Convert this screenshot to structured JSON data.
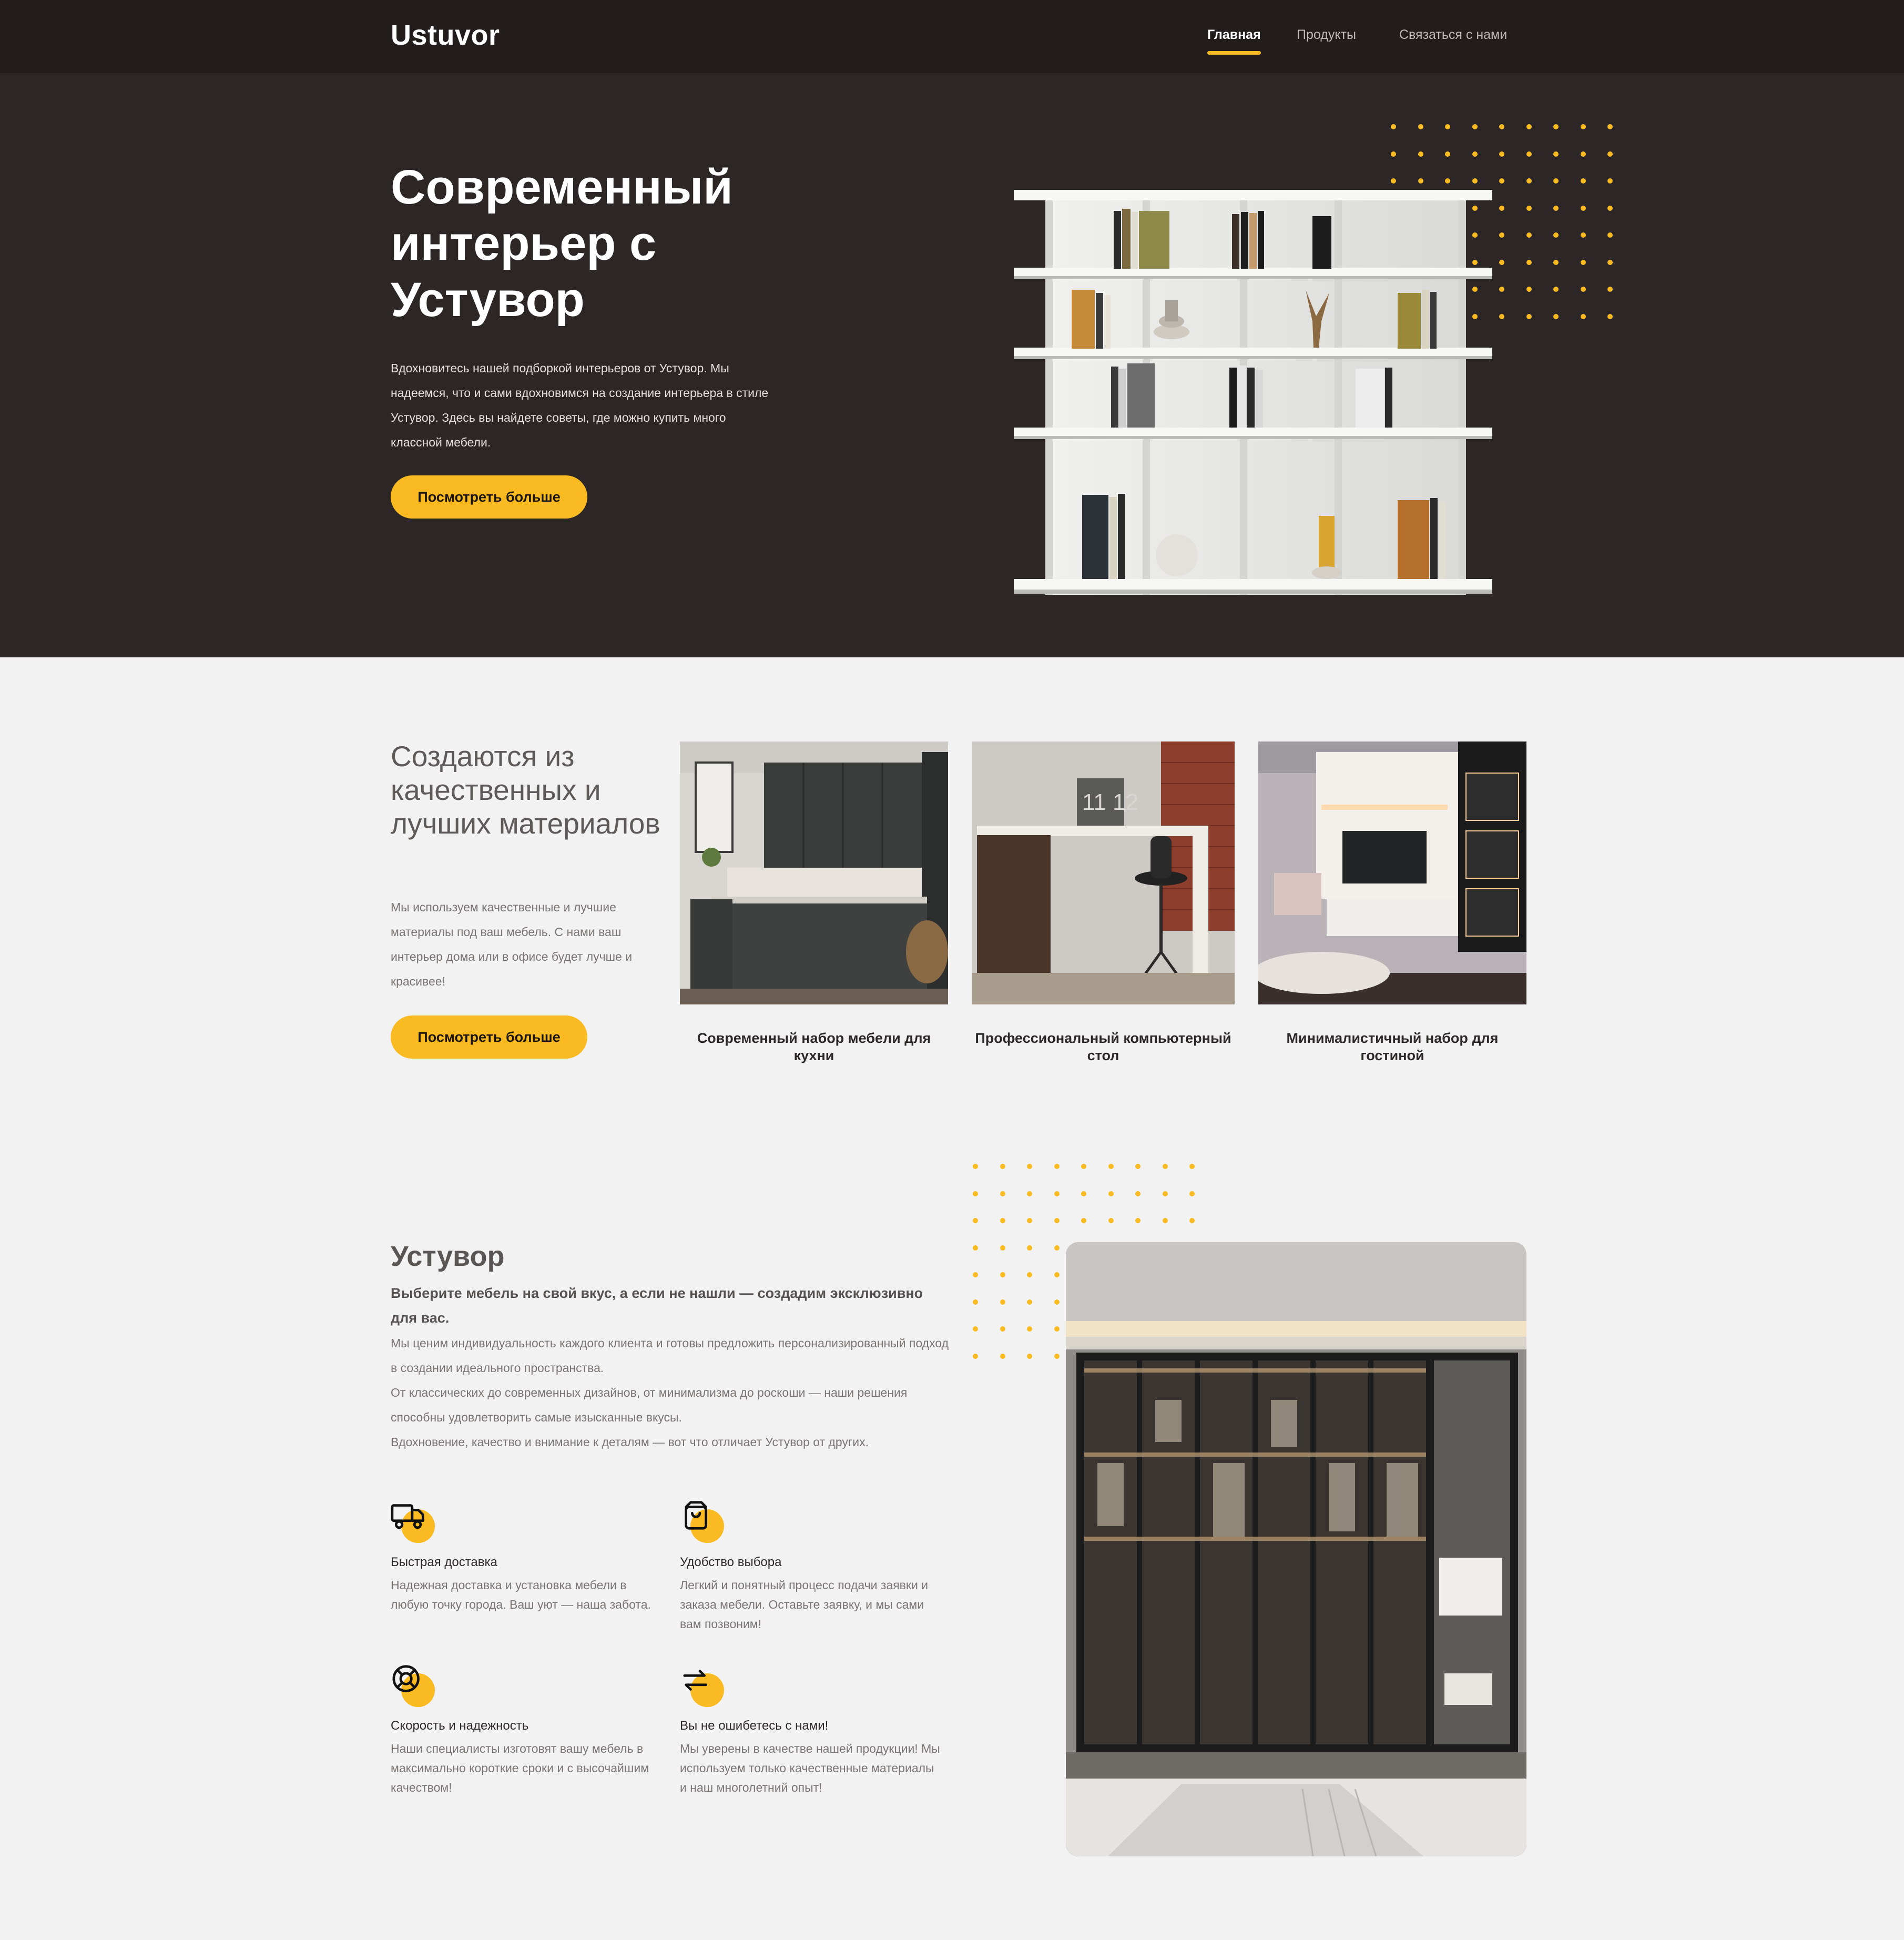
{
  "header": {
    "logo": "Ustuvor",
    "nav": [
      {
        "label": "Главная",
        "active": true
      },
      {
        "label": "Продукты",
        "active": false
      },
      {
        "label": "Связаться с нами",
        "active": false
      }
    ]
  },
  "hero": {
    "title": "Современный интерьер с Устувор",
    "text": "Вдохновитесь нашей подборкой интерьеров от Устувор. Мы надеемся, что и сами вдохновимся на создание интерьера в стиле Устувор. Здесь вы найдете советы, где можно купить много классной мебели.",
    "button": "Посмотреть больше"
  },
  "materials": {
    "title": "Создаются из качественных и лучших материалов",
    "text": "Мы используем качественные и лучшие материалы под ваш мебель. С нами ваш интерьер дома или в офисе будет лучше и красивее!",
    "button": "Посмотреть больше",
    "cards": [
      {
        "caption": "Современный набор мебели для кухни"
      },
      {
        "caption": "Профессиональный компьютерный стол"
      },
      {
        "caption": "Минималистичный набор для гостиной"
      }
    ]
  },
  "ustuvor": {
    "title": "Устувор",
    "subtitle": "Выберите мебель на свой вкус, а если не нашли — создадим эксклюзивно для вас.",
    "paragraphs": [
      "Мы ценим индивидуальность каждого клиента и готовы предложить персонализированный подход в создании идеального пространства.",
      "От классических до современных дизайнов, от минимализма до роскоши — наши решения способны удовлетворить самые изысканные вкусы.",
      "Вдохновение, качество и внимание к деталям — вот что отличает Устувор от других."
    ],
    "features": [
      {
        "icon": "truck-icon",
        "title": "Быстрая доставка",
        "text": "Надежная доставка и установка мебели в любую точку города. Ваш уют — наша забота."
      },
      {
        "icon": "shopping-bag-icon",
        "title": "Удобство выбора",
        "text": "Легкий и понятный процесс подачи заявки и заказа мебели. Оставьте заявку, и мы сами вам позвоним!"
      },
      {
        "icon": "lifebuoy-icon",
        "title": "Скорость и надежность",
        "text": "Наши специалисты изготовят вашу мебель в максимально короткие сроки и с высочайшим качеством!"
      },
      {
        "icon": "repeat-icon",
        "title": "Вы не ошибетесь с нами!",
        "text": "Мы уверены в качестве нашей продукции! Мы используем только качественные материалы и наш многолетний опыт!"
      }
    ]
  },
  "colors": {
    "accent": "#f9bb21",
    "header_bg": "#221c1c",
    "hero_bg": "#2c2627",
    "page_bg": "#f1f2f1"
  }
}
